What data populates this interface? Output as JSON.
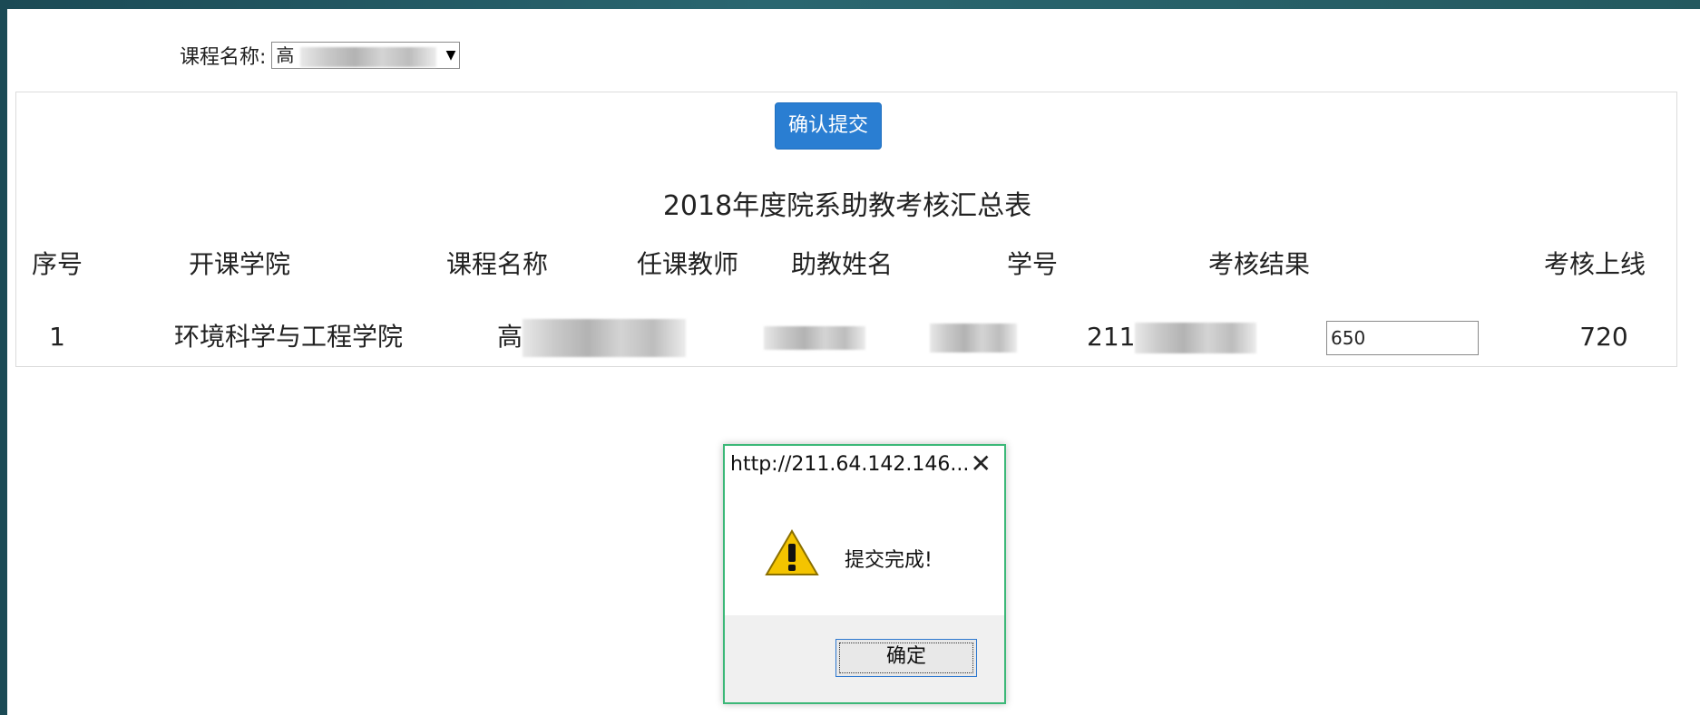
{
  "course_filter": {
    "label": "课程名称:",
    "selected_prefix": "高",
    "arrow_icon": "dropdown-arrow-icon"
  },
  "panel": {
    "submit_label": "确认提交",
    "title": "2018年度院系助教考核汇总表",
    "headers": [
      "序号",
      "开课学院",
      "课程名称",
      "任课教师",
      "助教姓名",
      "学号",
      "考核结果",
      "考核上线"
    ],
    "rows": [
      {
        "index": "1",
        "college": "环境科学与工程学院",
        "course_prefix": "高",
        "student_id_prefix": "211",
        "result": "650",
        "upper_limit": "720"
      }
    ]
  },
  "dialog": {
    "title": "http://211.64.142.146...",
    "close_icon": "close-icon",
    "warning_icon": "warning-icon",
    "message": "提交完成!",
    "ok_label": "确定"
  },
  "colors": {
    "submit_button": "#2a7ed2",
    "dialog_border": "#3cb878",
    "background": "#24595f"
  }
}
